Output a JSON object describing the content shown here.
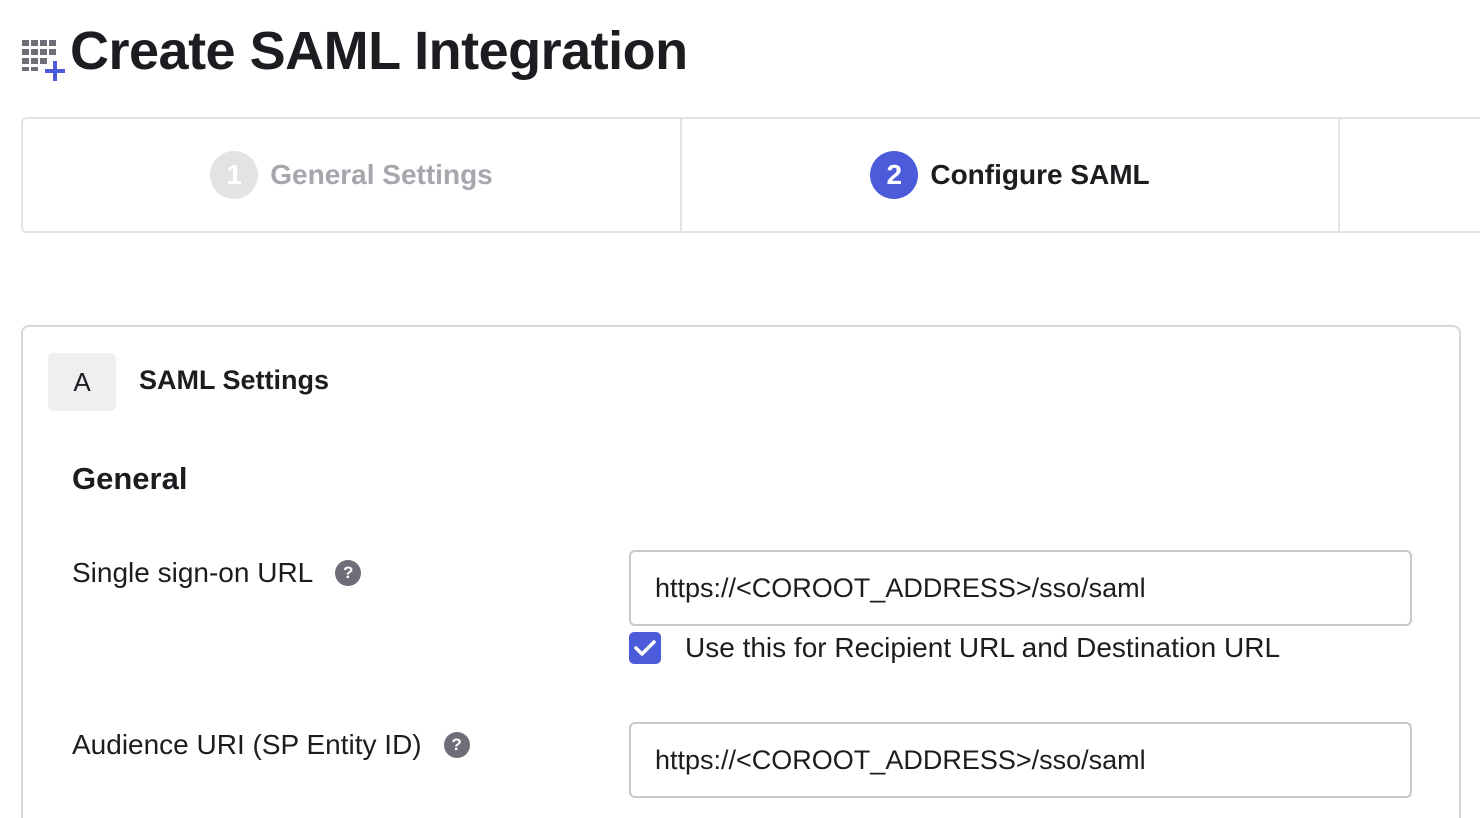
{
  "header": {
    "title": "Create SAML Integration",
    "icon": "app-add-icon"
  },
  "stepper": {
    "steps": [
      {
        "number": "1",
        "label": "General Settings",
        "state": "inactive"
      },
      {
        "number": "2",
        "label": "Configure SAML",
        "state": "active"
      }
    ]
  },
  "section": {
    "badge": "A",
    "title": "SAML Settings",
    "subsection": "General"
  },
  "fields": {
    "sso_url": {
      "label": "Single sign-on URL",
      "value": "https://<COROOT_ADDRESS>/sso/saml",
      "help_icon": "question-icon"
    },
    "recipient_checkbox": {
      "label": "Use this for Recipient URL and Destination URL",
      "checked": true
    },
    "audience_uri": {
      "label": "Audience URI (SP Entity ID)",
      "value": "https://<COROOT_ADDRESS>/sso/saml",
      "help_icon": "question-icon"
    }
  },
  "colors": {
    "accent": "#4b5bd9",
    "text": "#1d1d21",
    "muted": "#a6a6ad",
    "border": "#e3e3e6"
  }
}
